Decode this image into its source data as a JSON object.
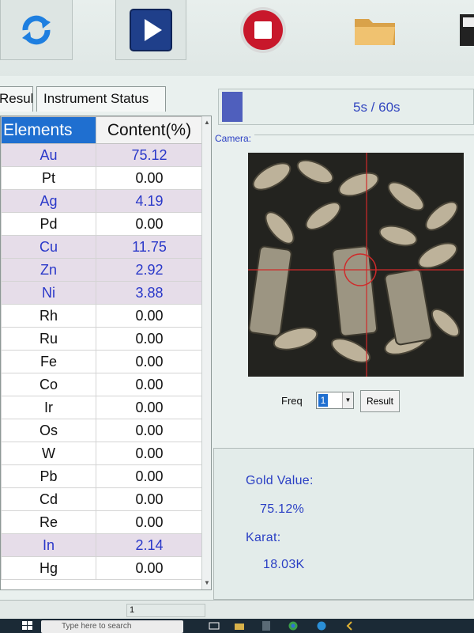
{
  "toolbar": {
    "buttons": [
      {
        "name": "refresh",
        "icon": "refresh-icon"
      },
      {
        "name": "start",
        "icon": "play-icon"
      },
      {
        "name": "stop",
        "icon": "stop-icon"
      },
      {
        "name": "open",
        "icon": "folder-icon"
      },
      {
        "name": "save",
        "icon": "save-icon"
      }
    ]
  },
  "tabs": {
    "result": "Result",
    "instrument_status": "Instrument Status"
  },
  "table": {
    "headers": [
      "Elements",
      "Content(%)"
    ],
    "rows": [
      {
        "element": "Au",
        "content": "75.12",
        "highlight": true
      },
      {
        "element": "Pt",
        "content": "0.00",
        "highlight": false
      },
      {
        "element": "Ag",
        "content": "4.19",
        "highlight": true
      },
      {
        "element": "Pd",
        "content": "0.00",
        "highlight": false
      },
      {
        "element": "Cu",
        "content": "11.75",
        "highlight": true
      },
      {
        "element": "Zn",
        "content": "2.92",
        "highlight": true
      },
      {
        "element": "Ni",
        "content": "3.88",
        "highlight": true
      },
      {
        "element": "Rh",
        "content": "0.00",
        "highlight": false
      },
      {
        "element": "Ru",
        "content": "0.00",
        "highlight": false
      },
      {
        "element": "Fe",
        "content": "0.00",
        "highlight": false
      },
      {
        "element": "Co",
        "content": "0.00",
        "highlight": false
      },
      {
        "element": "Ir",
        "content": "0.00",
        "highlight": false
      },
      {
        "element": "Os",
        "content": "0.00",
        "highlight": false
      },
      {
        "element": "W",
        "content": "0.00",
        "highlight": false
      },
      {
        "element": "Pb",
        "content": "0.00",
        "highlight": false
      },
      {
        "element": "Cd",
        "content": "0.00",
        "highlight": false
      },
      {
        "element": "Re",
        "content": "0.00",
        "highlight": false
      },
      {
        "element": "In",
        "content": "2.14",
        "highlight": true
      },
      {
        "element": "Hg",
        "content": "0.00",
        "highlight": false
      }
    ]
  },
  "progress": {
    "time": "5s / 60s",
    "fraction": 0.0833
  },
  "camera": {
    "label": "Camera:",
    "freq_label": "Freq",
    "freq_value": "1",
    "result_button": "Result"
  },
  "result": {
    "gold_label": "Gold Value:",
    "gold_value": "75.12%",
    "karat_label": "Karat:",
    "karat_value": "18.03K"
  },
  "status": {
    "page": "1"
  },
  "taskbar": {
    "search_placeholder": "Type here to search"
  },
  "colors": {
    "accent_blue": "#1f6fd0",
    "value_blue": "#2a3fc4",
    "highlight_row": "#e6dde9",
    "progress_fill": "#4f5fbd"
  }
}
